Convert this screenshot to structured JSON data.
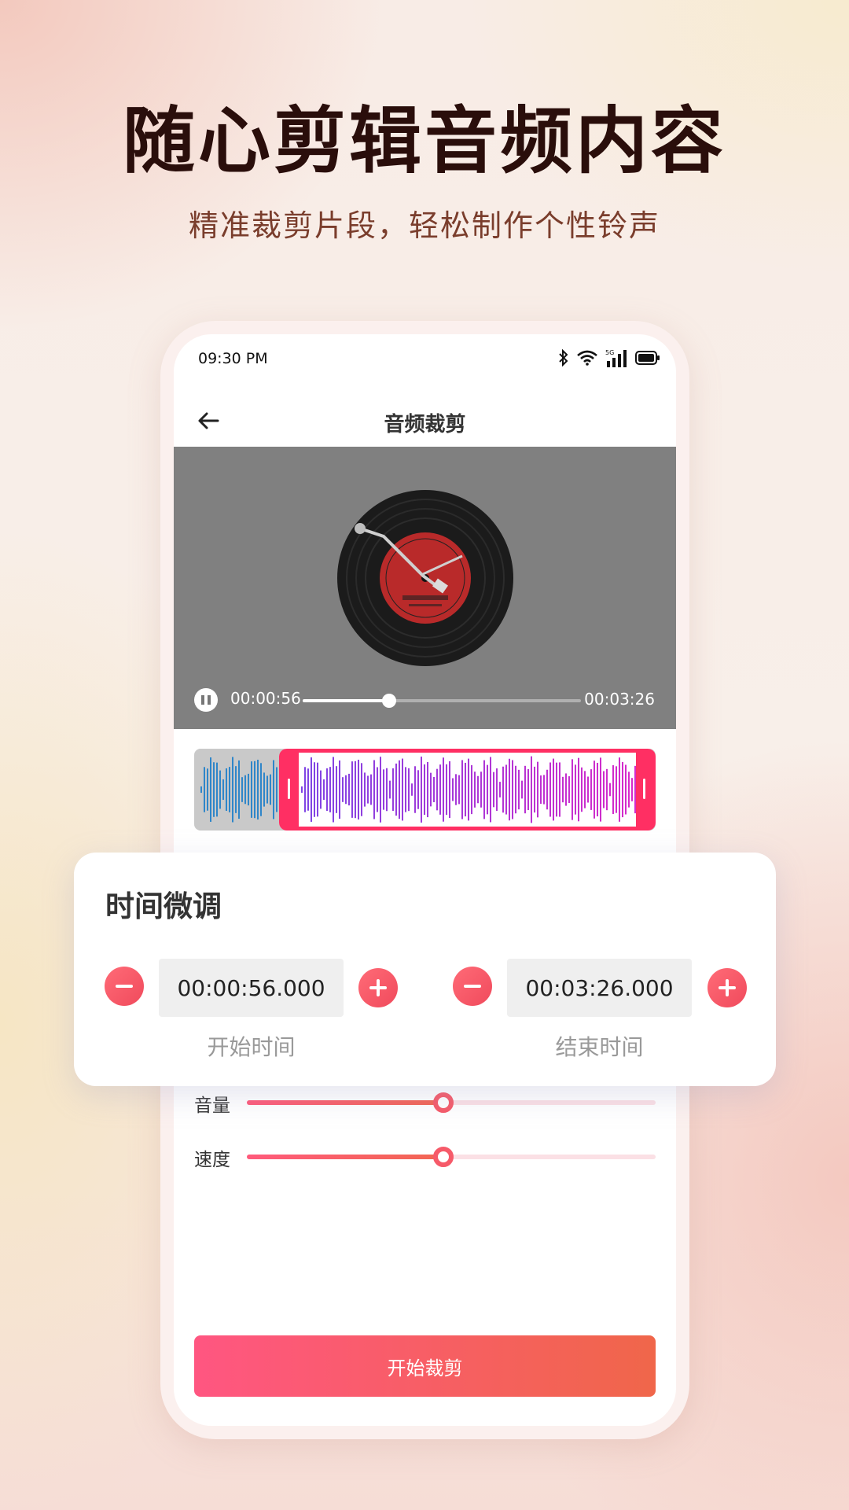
{
  "promo": {
    "headline": "随心剪辑音频内容",
    "subline": "精准裁剪片段，轻松制作个性铃声"
  },
  "status_bar": {
    "time": "09:30 PM",
    "icons": [
      "bluetooth-icon",
      "wifi-icon",
      "5g-signal-icon",
      "battery-icon"
    ],
    "network_label": "5G"
  },
  "nav": {
    "title": "音频裁剪"
  },
  "player": {
    "current_time": "00:00:56",
    "total_time": "00:03:26",
    "progress": 0.31
  },
  "waveform": {
    "selection_start_fraction": 0.19,
    "selection_end_fraction": 1.0
  },
  "controls": {
    "volume_label": "音量",
    "volume_value": 0.48,
    "speed_label": "速度",
    "speed_value": 0.48
  },
  "cut_button": {
    "label": "开始裁剪"
  },
  "fine_tune": {
    "title": "时间微调",
    "start_value": "00:00:56.000",
    "start_label": "开始时间",
    "end_value": "00:03:26.000",
    "end_label": "结束时间"
  },
  "colors": {
    "accent": "#ff2f63",
    "button_gradient_start": "#ff5681",
    "button_gradient_end": "#f0664a"
  }
}
